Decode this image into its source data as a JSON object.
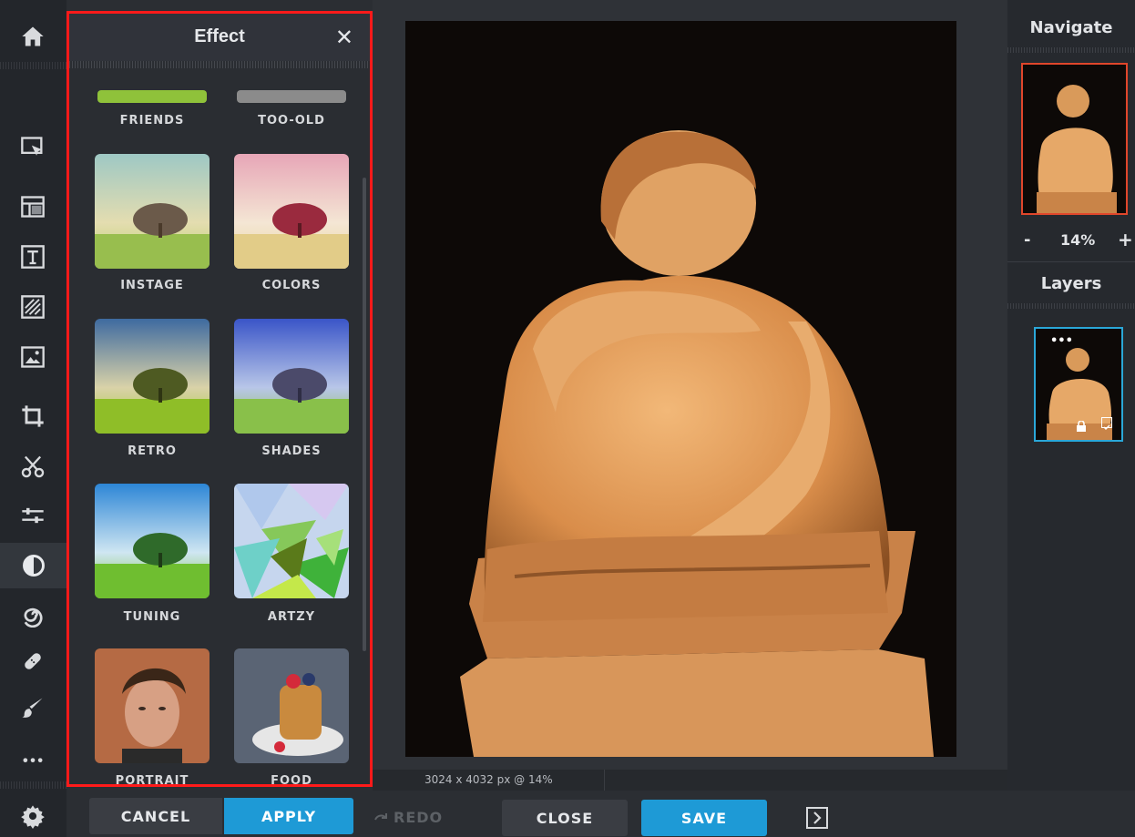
{
  "panel": {
    "title": "Effect",
    "close_glyph": "✕",
    "effects": [
      {
        "label": "FRIENDS"
      },
      {
        "label": "TOO-OLD"
      },
      {
        "label": "INSTAGE"
      },
      {
        "label": "COLORS"
      },
      {
        "label": "RETRO"
      },
      {
        "label": "SHADES"
      },
      {
        "label": "TUNING"
      },
      {
        "label": "ARTZY"
      },
      {
        "label": "PORTRAIT"
      },
      {
        "label": "FOOD"
      }
    ]
  },
  "toolbar": {
    "icons": [
      "home-icon",
      "select-icon",
      "layout-icon",
      "text-icon",
      "texture-icon",
      "image-icon",
      "crop-icon",
      "cutout-icon",
      "adjust-icon",
      "effect-icon",
      "distort-icon",
      "heal-icon",
      "brush-icon",
      "more-icon",
      "settings-icon"
    ],
    "active": "effect-icon"
  },
  "canvas": {
    "status": "3024 x 4032 px @ 14%"
  },
  "navigate": {
    "title": "Navigate",
    "zoom_minus": "-",
    "zoom_value": "14%",
    "zoom_plus": "+"
  },
  "layers": {
    "title": "Layers",
    "more_glyph": "•••"
  },
  "actions": {
    "cancel": "CANCEL",
    "apply": "APPLY",
    "redo": "REDO",
    "close": "CLOSE",
    "save": "SAVE"
  },
  "colors": {
    "accent": "#1e9ad6",
    "highlight_border": "#ff1a1a",
    "layer_border": "#2aa7d8",
    "navigate_border": "#e0462b"
  }
}
